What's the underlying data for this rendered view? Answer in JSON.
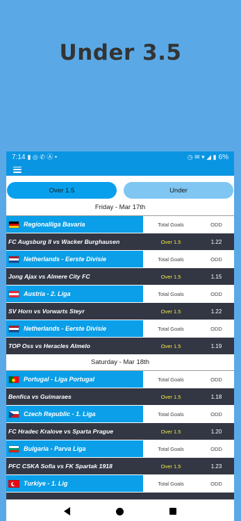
{
  "promo": {
    "title": "Under 3.5"
  },
  "status_bar": {
    "time": "7:14",
    "battery": "6%"
  },
  "tabs": [
    {
      "label": "Over 1.5"
    },
    {
      "label": "Under"
    }
  ],
  "days": [
    {
      "date": "Friday - Mar 17th",
      "leagues": [
        {
          "flag": "germany",
          "name": "Regionalliga Bavaria",
          "col_goals": "Total Goals",
          "col_odd": "ODD",
          "match": {
            "teams": "FC Augsburg II vs Wacker Burghausen",
            "tip": "Over 1.5",
            "odd": "1.22"
          }
        },
        {
          "flag": "netherlands",
          "name": "Netherlands - Eerste Divisie",
          "col_goals": "Total Goals",
          "col_odd": "ODD",
          "match": {
            "teams": "Jong Ajax vs Almere City FC",
            "tip": "Over 1.5",
            "odd": "1.15"
          }
        },
        {
          "flag": "austria",
          "name": "Austria - 2. Liga",
          "col_goals": "Total Goals",
          "col_odd": "ODD",
          "match": {
            "teams": "SV Horn vs Vorwarts Steyr",
            "tip": "Over 1.5",
            "odd": "1.22"
          }
        },
        {
          "flag": "netherlands",
          "name": "Netherlands - Eerste Divisie",
          "col_goals": "Total Goals",
          "col_odd": "ODD",
          "match": {
            "teams": "TOP Oss vs Heracles Almelo",
            "tip": "Over 1.5",
            "odd": "1.19"
          }
        }
      ]
    },
    {
      "date": "Saturday - Mar 18th",
      "leagues": [
        {
          "flag": "portugal",
          "name": "Portugal - Liga Portugal",
          "col_goals": "Total Goals",
          "col_odd": "ODD",
          "match": {
            "teams": "Benfica vs Guimaraes",
            "tip": "Over 1.5",
            "odd": "1.18"
          }
        },
        {
          "flag": "czech",
          "name": "Czech Republic - 1. Liga",
          "col_goals": "Total Goals",
          "col_odd": "ODD",
          "match": {
            "teams": "FC Hradec Kralove vs Sparta Prague",
            "tip": "Over 1.5",
            "odd": "1.20"
          }
        },
        {
          "flag": "bulgaria",
          "name": "Bulgaria - Parva Liga",
          "col_goals": "Total Goals",
          "col_odd": "ODD",
          "match": {
            "teams": "PFC CSKA Sofia vs FK Spartak 1918",
            "tip": "Over 1.5",
            "odd": "1.23"
          }
        },
        {
          "flag": "turkey",
          "name": "Turkiye - 1. Lig",
          "col_goals": "Total Goals",
          "col_odd": "ODD",
          "match": null
        }
      ]
    }
  ],
  "colors": {
    "background": "#5aa9e6",
    "accent": "#0a9fe8",
    "match_row": "#333744",
    "tip_text": "#f6e840"
  },
  "icons": [
    "menu-icon",
    "back-icon",
    "home-icon",
    "recents-icon"
  ]
}
